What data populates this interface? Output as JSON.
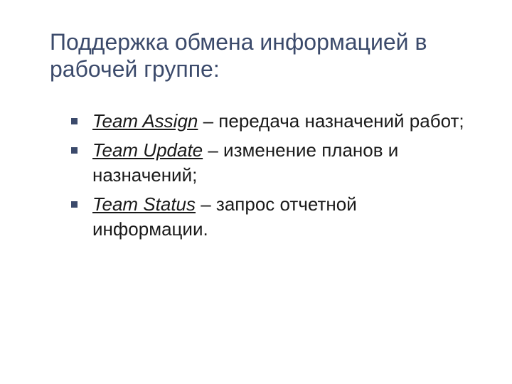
{
  "title": "Поддержка обмена информацией в рабочей группе:",
  "items": [
    {
      "term": "Team Assign",
      "desc": " – передача назначений работ;"
    },
    {
      "term": "Team Update",
      "desc": " – изменение планов и назначений;"
    },
    {
      "term": "Team Status",
      "desc": " – запрос отчетной информации."
    }
  ]
}
